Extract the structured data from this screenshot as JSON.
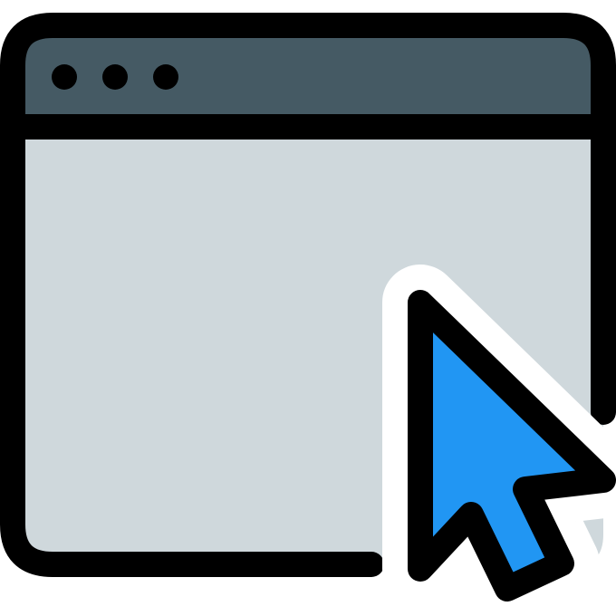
{
  "icon": {
    "window_icon": "browser-window-icon",
    "cursor_icon": "mouse-pointer-icon"
  },
  "colors": {
    "outline": "#000000",
    "title_bar": "#455A64",
    "content_area": "#CFD8DC",
    "cursor_fill": "#2196F3",
    "cursor_halo": "#FFFFFF",
    "background": "#FFFFFF"
  },
  "window": {
    "control_dots": [
      {
        "name": "window-dot-1"
      },
      {
        "name": "window-dot-2"
      },
      {
        "name": "window-dot-3"
      }
    ]
  }
}
